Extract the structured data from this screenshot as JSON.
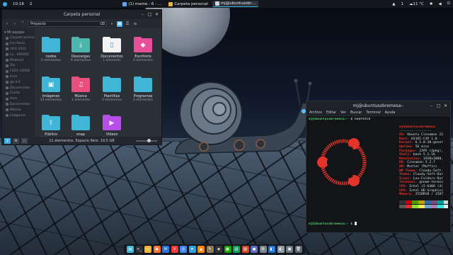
{
  "colors": {
    "accent": "#3daee9",
    "folder": "#3fb6d6",
    "term_red": "#e2342a",
    "term_green": "#55c26a"
  },
  "top_panel": {
    "menu_icon": "start-menu-icon",
    "time": "10:18",
    "workspace": "2",
    "tasks": [
      {
        "label": "(1) mame ‑ 6 ‑ …",
        "icon": "video-icon",
        "color": "#5fa8f0",
        "active": false
      },
      {
        "label": "Carpeta personal",
        "icon": "folder-icon",
        "color": "#e9b53f",
        "active": false
      },
      {
        "label": "mj@ubuntusobr…",
        "icon": "terminal-icon",
        "color": "#cfd3d8",
        "active": true
      }
    ],
    "tray_battery": "1",
    "tray_temp": "11 °C"
  },
  "file_manager": {
    "title": "Carpeta personal",
    "path": "Proyecto",
    "sidebar_header": "Mi equipo",
    "sidebar_items": [
      "Carpeta personal",
      "Escritorio",
      "19.6.2023",
      "Lu…000000",
      "MLblood",
      "Zip",
      "FILES 10008",
      "€uro",
      "git-4.0",
      "Documentos",
      "Cluilla",
      "Arca",
      "Documentos",
      "Música",
      "Imágenes"
    ],
    "items": [
      {
        "name": "nodos",
        "count": "5 elementos",
        "color": "#3fb6d6",
        "icon": ""
      },
      {
        "name": "Descargas",
        "count": "6 elementos",
        "color": "#4db6ac",
        "icon": "⤓"
      },
      {
        "name": "Documentos",
        "count": "1 elemento",
        "color": "#f4f4f4",
        "icon": "▯"
      },
      {
        "name": "Escritorio",
        "count": "0 elementos",
        "color": "#e84f9b",
        "icon": "◆"
      },
      {
        "name": "Imágenes",
        "count": "14 elementos",
        "color": "#3fb6d6",
        "icon": "▣"
      },
      {
        "name": "Música",
        "count": "1 elemento",
        "color": "#e84f7f",
        "icon": "♫"
      },
      {
        "name": "Plantillas",
        "count": "0 elementos",
        "color": "#3fb6d6",
        "icon": ""
      },
      {
        "name": "Programas",
        "count": "4 elementos",
        "color": "#3fb6d6",
        "icon": ""
      },
      {
        "name": "Público",
        "count": "0 elementos",
        "color": "#3fb6d6",
        "icon": "⇪"
      },
      {
        "name": "snap",
        "count": "5 elementos",
        "color": "#3fb6d6",
        "icon": ""
      },
      {
        "name": "Vídeos",
        "count": "1 elemento",
        "color": "#b44fe8",
        "icon": "▶"
      }
    ],
    "status": "11 elementos, Espacio libre: 19,5 GB"
  },
  "terminal": {
    "title": "mj@ubuntusobremesa:-",
    "menu": [
      "Archivo",
      "Editar",
      "Ver",
      "Buscar",
      "Terminal",
      "Ayuda"
    ],
    "prompt_user": "mj@ubuntusobremesa:",
    "prompt_dir": "~",
    "command": "$ neofetch",
    "info_header": "mj@ubuntusobremesa",
    "info_sep": "----------------",
    "info": [
      {
        "k": "OS:",
        "v": " Ubuntu Cinnamon 22"
      },
      {
        "k": "Host:",
        "v": " H110I-C4P 1.0"
      },
      {
        "k": "Kernel:",
        "v": " 6.5.0-38-gener"
      },
      {
        "k": "Uptime:",
        "v": " 56 mins"
      },
      {
        "k": "Packages:",
        "v": " 2395 (dpkg),"
      },
      {
        "k": "Shell:",
        "v": " bash 5.1.16"
      },
      {
        "k": "Resolution:",
        "v": " 1920x1080,"
      },
      {
        "k": "DE:",
        "v": " Cinnamon 5.2.7"
      },
      {
        "k": "WM:",
        "v": " Mutter (Muffin)"
      },
      {
        "k": "WM Theme:",
        "v": " Cloudy-Soft-"
      },
      {
        "k": "Theme:",
        "v": " Cloudy-Soft-Dar"
      },
      {
        "k": "Icons:",
        "v": " Luv-Folders-Dar"
      },
      {
        "k": "Terminal:",
        "v": " gnome-termin"
      },
      {
        "k": "CPU:",
        "v": " Intel i5-6400 (4)"
      },
      {
        "k": "GPU:",
        "v": " Intel HD Graphics"
      },
      {
        "k": "Memory:",
        "v": " 2550MiB / 1587"
      }
    ],
    "palette_row1": [
      "#2e3436",
      "#cc0000",
      "#4e9a06",
      "#c4a000",
      "#3465a4",
      "#75507b",
      "#06989a",
      "#d3d7cf"
    ],
    "palette_row2": [
      "#555753",
      "#ef2929",
      "#8ae234",
      "#fce94f",
      "#729fcf",
      "#ad7fa8",
      "#34e2e2",
      "#eeeeec"
    ],
    "final_prompt": "$"
  },
  "dock": [
    {
      "icon": "files-icon",
      "color": "#3fb6d6",
      "glyph": "▤"
    },
    {
      "icon": "terminal-icon",
      "color": "#2b2f36",
      "glyph": ">_"
    },
    {
      "icon": "folder-icon",
      "color": "#e9b53f",
      "glyph": "▭"
    },
    {
      "icon": "firefox-icon",
      "color": "#ff7139",
      "glyph": "◉"
    },
    {
      "icon": "thunderbird-icon",
      "color": "#2a74d9",
      "glyph": "✉"
    },
    {
      "icon": "vivaldi-icon",
      "color": "#ef3939",
      "glyph": "V"
    },
    {
      "icon": "chrome-icon",
      "color": "#4285f4",
      "glyph": "◎"
    },
    {
      "icon": "telegram-icon",
      "color": "#2aa3df",
      "glyph": "➤"
    },
    {
      "icon": "vlc-icon",
      "color": "#ff8800",
      "glyph": "▲"
    },
    {
      "icon": "gimp-icon",
      "color": "#8a7a5a",
      "glyph": "✎"
    },
    {
      "icon": "inkscape-icon",
      "color": "#333333",
      "glyph": "◈"
    },
    {
      "icon": "libreoffice-icon",
      "color": "#18a303",
      "glyph": "▦"
    },
    {
      "icon": "calc-icon",
      "color": "#0f9d58",
      "glyph": "▥"
    },
    {
      "icon": "impress-icon",
      "color": "#d24726",
      "glyph": "▧"
    },
    {
      "icon": "software-icon",
      "color": "#5c6bc0",
      "glyph": "◼"
    },
    {
      "icon": "settings-icon",
      "color": "#7a8593",
      "glyph": "⚙"
    },
    {
      "icon": "appstore-icon",
      "color": "#1976d2",
      "glyph": "◧"
    },
    {
      "icon": "timeshift-icon",
      "color": "#8c9aa8",
      "glyph": "◐"
    },
    {
      "icon": "screenshot-icon",
      "color": "#6a7684",
      "glyph": "▣"
    },
    {
      "icon": "trash-icon",
      "color": "#5c6a79",
      "glyph": "🗑"
    }
  ]
}
